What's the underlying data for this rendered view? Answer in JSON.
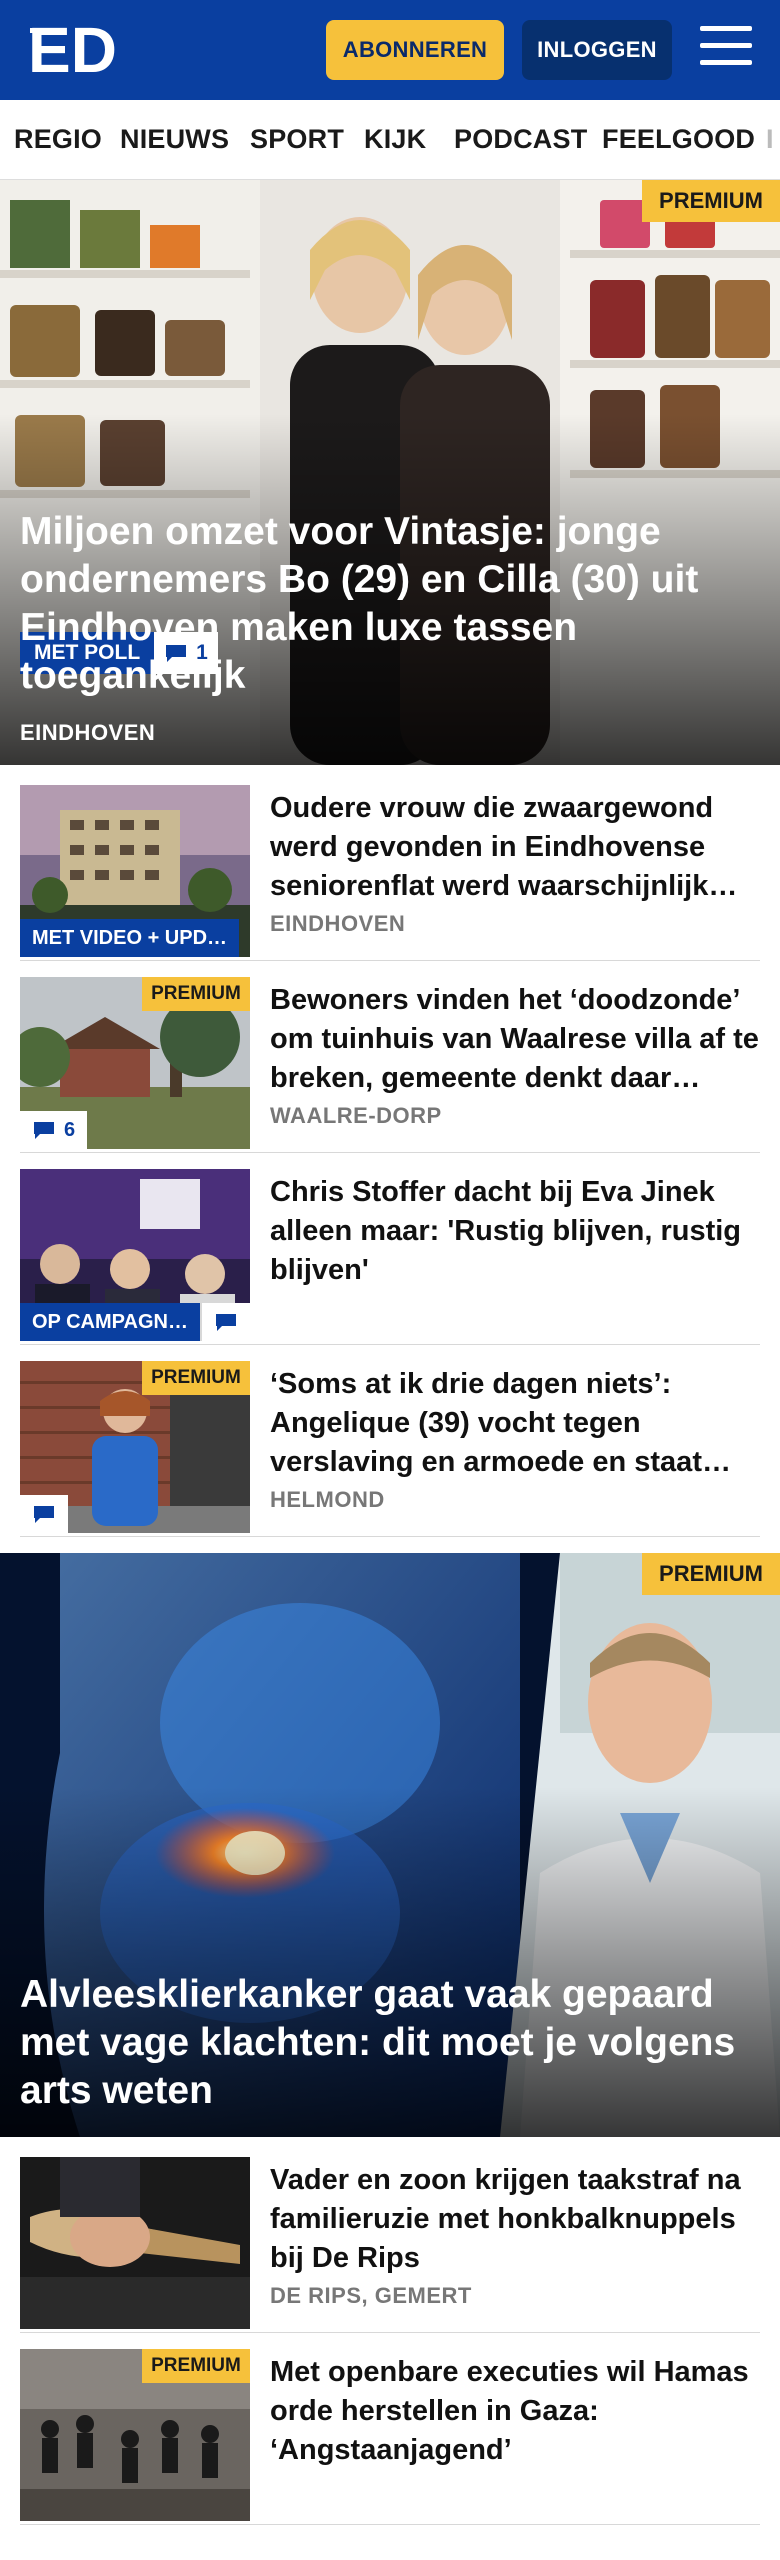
{
  "header": {
    "logo_text": "ED",
    "subscribe_label": "ABONNEREN",
    "login_label": "INLOGGEN"
  },
  "nav": {
    "items": [
      "REGIO",
      "NIEUWS",
      "SPORT",
      "KIJK",
      "PODCAST",
      "FEELGOOD"
    ]
  },
  "hero1": {
    "premium": "PREMIUM",
    "badge": "MET POLL",
    "comments": "1",
    "title": "Miljoen omzet voor Vintasje: jonge ondernemers Bo (29) en Cilla (30) uit Eindhoven maken luxe tassen toegankelijk",
    "location": "EINDHOVEN"
  },
  "list1": [
    {
      "title": "Oudere vrouw die zwaargewond werd gevonden in Eindhovense seniorenflat werd waarschijnlijk…",
      "location": "EINDHOVEN",
      "tag": "MET VIDEO + UPD…"
    },
    {
      "title": "Bewoners vinden het ‘doodzonde’ om tuinhuis van Waalrese villa af te breken, gemeente denkt daar…",
      "location": "WAALRE-DORP",
      "premium": "PREMIUM",
      "comments": "6"
    },
    {
      "title": "Chris Stoffer dacht bij Eva Jinek alleen maar: 'Rustig blijven, rustig blijven'",
      "location": "",
      "tag": "OP CAMPAGN…"
    },
    {
      "title": "‘Soms at ik drie dagen niets’: Angelique (39) vocht tegen verslaving en armoede en staat…",
      "location": "HELMOND",
      "premium": "PREMIUM"
    }
  ],
  "hero2": {
    "premium": "PREMIUM",
    "title": "Alvleesklierkanker gaat vaak gepaard met vage klachten: dit moet je volgens arts weten"
  },
  "list2": [
    {
      "title": "Vader en zoon krijgen taakstraf na familieruzie met honkbal­knuppels bij De Rips",
      "location": "DE RIPS, GEMERT"
    },
    {
      "title": "Met openbare executies wil Hamas orde herstellen in Gaza: ‘Angstaanjagend’",
      "location": "",
      "premium": "PREMIUM"
    }
  ],
  "colors": {
    "brand_blue": "#0a3fa0",
    "premium_yellow": "#f6c13b"
  },
  "icons": [
    "menu-icon",
    "comment-icon"
  ]
}
